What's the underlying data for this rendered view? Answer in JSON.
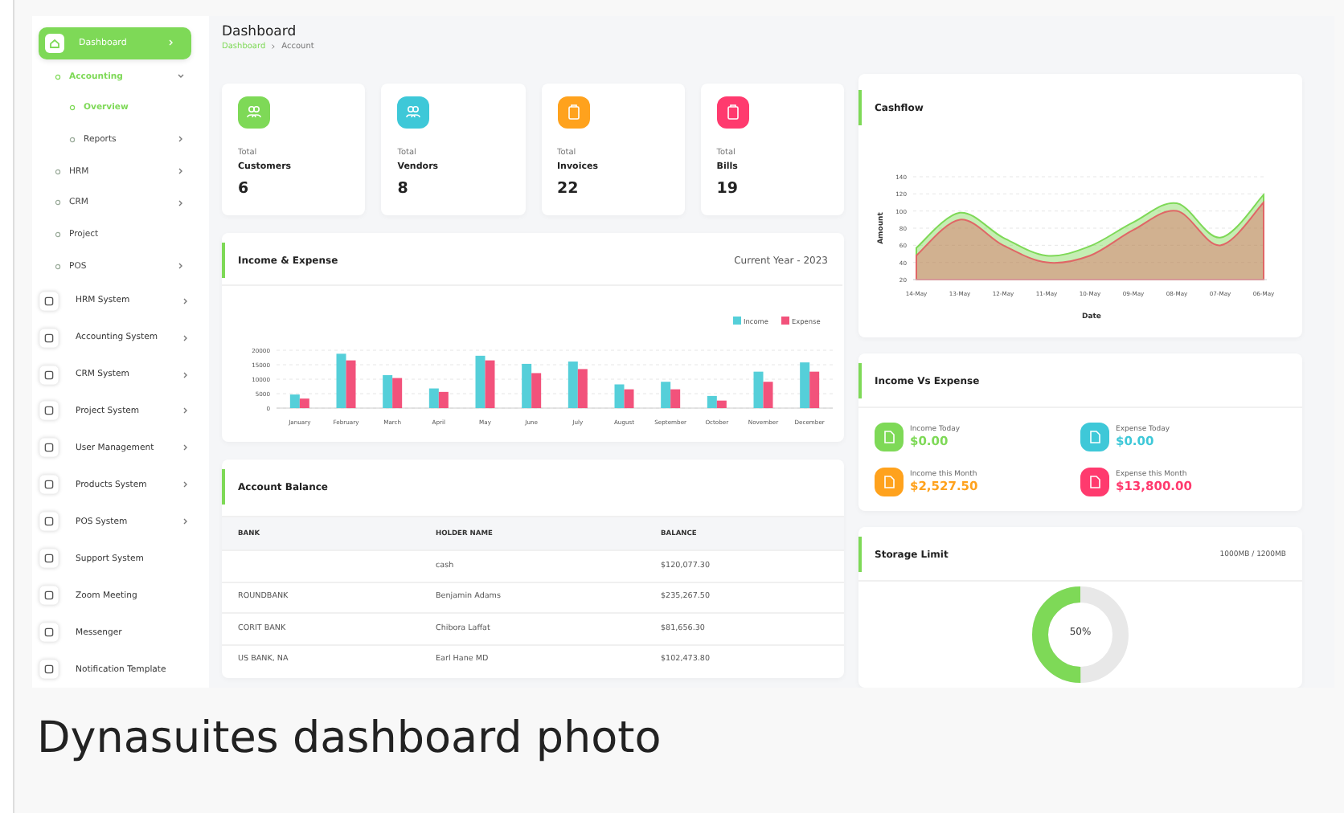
{
  "sidebar": {
    "items": [
      {
        "label": "Dashboard",
        "selected": true,
        "expanded": false,
        "children": [
          {
            "label": "Accounting",
            "selected": true,
            "expanded": true,
            "children": [
              {
                "label": "Overview",
                "selected": true
              },
              {
                "label": "Reports",
                "selected": false,
                "expanded": false
              }
            ]
          },
          {
            "label": "HRM",
            "selected": false,
            "expanded": false
          },
          {
            "label": "CRM",
            "selected": false,
            "expanded": false
          },
          {
            "label": "Project",
            "selected": false
          },
          {
            "label": "POS",
            "selected": false,
            "expanded": false
          }
        ]
      },
      {
        "label": "HRM System",
        "selected": false,
        "expanded": false
      },
      {
        "label": "Accounting System",
        "selected": false,
        "expanded": false
      },
      {
        "label": "CRM System",
        "selected": false,
        "expanded": false
      },
      {
        "label": "Project System",
        "selected": false,
        "expanded": false
      },
      {
        "label": "User Management",
        "selected": false,
        "expanded": false
      },
      {
        "label": "Products System",
        "selected": false,
        "expanded": false
      },
      {
        "label": "POS System",
        "selected": false,
        "expanded": false
      },
      {
        "label": "Support System",
        "selected": false
      },
      {
        "label": "Zoom Meeting",
        "selected": false
      },
      {
        "label": "Messenger",
        "selected": false
      },
      {
        "label": "Notification Template",
        "selected": false
      }
    ]
  },
  "header": {
    "title": "Dashboard",
    "breadcrumb": [
      "Dashboard",
      "Account"
    ]
  },
  "stats": [
    {
      "kind": "people",
      "color": "#7ed957",
      "caption": "Total",
      "label": "Customers",
      "value": "6"
    },
    {
      "kind": "people",
      "color": "#3ec8d8",
      "caption": "Total",
      "label": "Vendors",
      "value": "8"
    },
    {
      "kind": "document",
      "color": "#ffa21d",
      "caption": "Total",
      "label": "Invoices",
      "value": "22"
    },
    {
      "kind": "document",
      "color": "#ff3a6e",
      "caption": "Total",
      "label": "Bills",
      "value": "19"
    }
  ],
  "income_expense": {
    "title": "Income & Expense",
    "period": "Current Year - 2023",
    "chart_data": {
      "type": "bar",
      "categories": [
        "January",
        "February",
        "March",
        "April",
        "May",
        "June",
        "July",
        "August",
        "September",
        "October",
        "November",
        "December"
      ],
      "ylim": [
        0,
        20000
      ],
      "yticks": [
        0,
        5000,
        10000,
        15000,
        20000
      ],
      "grid": true,
      "legend": true,
      "series": [
        {
          "name": "Income",
          "color": "#55cfd9",
          "values": [
            4700,
            18800,
            11400,
            6800,
            18100,
            15300,
            16100,
            8200,
            9100,
            4200,
            12600,
            15800
          ]
        },
        {
          "name": "Expense",
          "color": "#f2527b",
          "values": [
            3300,
            16500,
            10400,
            5600,
            16500,
            12100,
            13500,
            6500,
            6500,
            2600,
            9100,
            12600
          ]
        }
      ]
    }
  },
  "account_balance": {
    "title": "Account Balance",
    "columns": [
      "BANK",
      "HOLDER NAME",
      "BALANCE"
    ],
    "rows": [
      {
        "holder_name": "cash",
        "balance": "$120,077.30"
      },
      {
        "bank": "ROUNDBANK",
        "holder_name": "Benjamin Adams",
        "balance": "$235,267.50"
      },
      {
        "bank": "CORIT BANK",
        "holder_name": "Chibora Laffat",
        "balance": "$81,656.30"
      },
      {
        "bank": "US BANK, NA",
        "holder_name": "Earl Hane MD",
        "balance": "$102,473.80"
      }
    ]
  },
  "cashflow": {
    "title": "Cashflow",
    "chart_data": {
      "type": "area",
      "xlabel": "Date",
      "ylabel": "Amount",
      "x": [
        "14-May",
        "13-May",
        "12-May",
        "11-May",
        "10-May",
        "09-May",
        "08-May",
        "07-May",
        "06-May"
      ],
      "ylim": [
        20,
        140
      ],
      "yticks": [
        20,
        40,
        60,
        80,
        100,
        120,
        140
      ],
      "grid": true,
      "stacked": false,
      "series": [
        {
          "color": "#7ed957",
          "values": [
            57,
            98,
            69,
            48,
            59,
            87,
            109,
            69,
            119
          ]
        },
        {
          "color": "#e06666",
          "values": [
            48,
            90,
            60,
            40,
            48,
            78,
            100,
            60,
            110
          ]
        }
      ]
    }
  },
  "income_vs_expense": {
    "title": "Income Vs Expense",
    "items": [
      {
        "color": "#7ed957",
        "label": "Income Today",
        "amount": "$0.00"
      },
      {
        "color": "#3ec8d8",
        "label": "Expense Today",
        "amount": "$0.00"
      },
      {
        "color": "#ffa21d",
        "label": "Income this Month",
        "amount": "$2,527.50"
      },
      {
        "color": "#ff3a6e",
        "label": "Expense this Month",
        "amount": "$13,800.00"
      }
    ]
  },
  "storage": {
    "title": "Storage Limit",
    "usage": "1000MB / 1200MB",
    "level": 0.5,
    "reading": "50%"
  },
  "caption": "Dynasuites dashboard photo"
}
